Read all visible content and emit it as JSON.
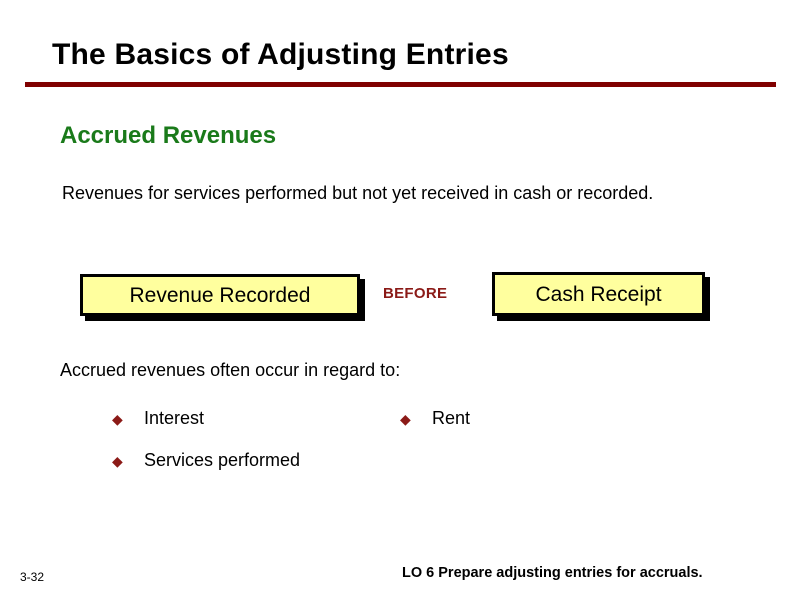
{
  "slide": {
    "title": "The Basics of Adjusting Entries",
    "page_number": "3-32",
    "accent_rule_color": "#800000"
  },
  "section": {
    "heading": "Accrued Revenues",
    "heading_color": "#1a7a1a",
    "intro": "Revenues for services performed but not yet received in cash or recorded."
  },
  "flow": {
    "left_box_label": "Revenue Recorded",
    "connector_label": "BEFORE",
    "right_box_label": "Cash Receipt",
    "box_fill_color": "#ffff9e",
    "box_border_color": "#000000",
    "connector_color": "#8b1a17"
  },
  "examples": {
    "lead_in": "Accrued revenues often occur in regard to:",
    "bullet_glyph": "◆",
    "bullet_color": "#8b1a17",
    "left_column": [
      {
        "label": "Interest"
      },
      {
        "label": "Services performed"
      }
    ],
    "right_column": [
      {
        "label": "Rent"
      }
    ]
  },
  "footer": {
    "learning_objective": "LO 6  Prepare adjusting entries for accruals."
  }
}
